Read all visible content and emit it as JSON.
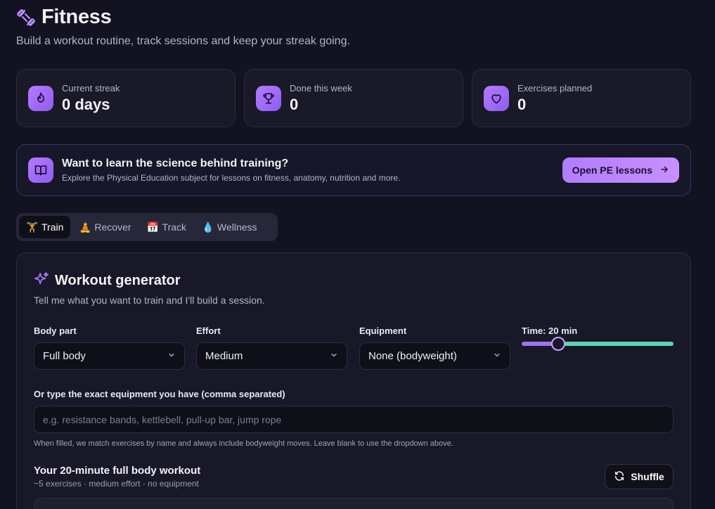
{
  "app": {
    "title": "Fitness",
    "subtitle": "Build a workout routine, track sessions and keep your streak going."
  },
  "stats": [
    {
      "label": "Current streak",
      "value": "0 days",
      "icon": "flame-icon"
    },
    {
      "label": "Done this week",
      "value": "0",
      "icon": "trophy-icon"
    },
    {
      "label": "Exercises planned",
      "value": "0",
      "icon": "heart-icon"
    }
  ],
  "promo": {
    "title": "Want to learn the science behind training?",
    "description": "Explore the Physical Education subject for lessons on fitness, anatomy, nutrition and more.",
    "button_label": "Open PE lessons",
    "icon": "book-icon"
  },
  "tabs": [
    {
      "label": "Train",
      "emoji": "🏋",
      "active": true
    },
    {
      "label": "Recover",
      "emoji": "🧘",
      "active": false
    },
    {
      "label": "Track",
      "emoji": "📅",
      "active": false
    },
    {
      "label": "Wellness",
      "emoji": "💧",
      "active": false
    }
  ],
  "generator": {
    "title": "Workout generator",
    "subtitle": "Tell me what you want to train and I'll build a session.",
    "body_part": {
      "label": "Body part",
      "value": "Full body"
    },
    "effort": {
      "label": "Effort",
      "value": "Medium"
    },
    "equipment": {
      "label": "Equipment",
      "value": "None (bodyweight)"
    },
    "time": {
      "label": "Time: 20 min",
      "value_fraction": 0.24
    },
    "equip_text": {
      "label": "Or type the exact equipment you have (comma separated)",
      "placeholder": "e.g. resistance bands, kettlebell, pull-up bar, jump rope",
      "value": "",
      "hint": "When filled, we match exercises by name and always include bodyweight moves. Leave blank to use the dropdown above."
    },
    "workout": {
      "title": "Your 20-minute full body workout",
      "meta": "~5 exercises · medium effort · no equipment",
      "shuffle_label": "Shuffle"
    }
  },
  "colors": {
    "accent": "#a874f8",
    "slider_fill": "#9d74f3",
    "slider_rest": "#5ed4b4",
    "background": "#121220"
  }
}
